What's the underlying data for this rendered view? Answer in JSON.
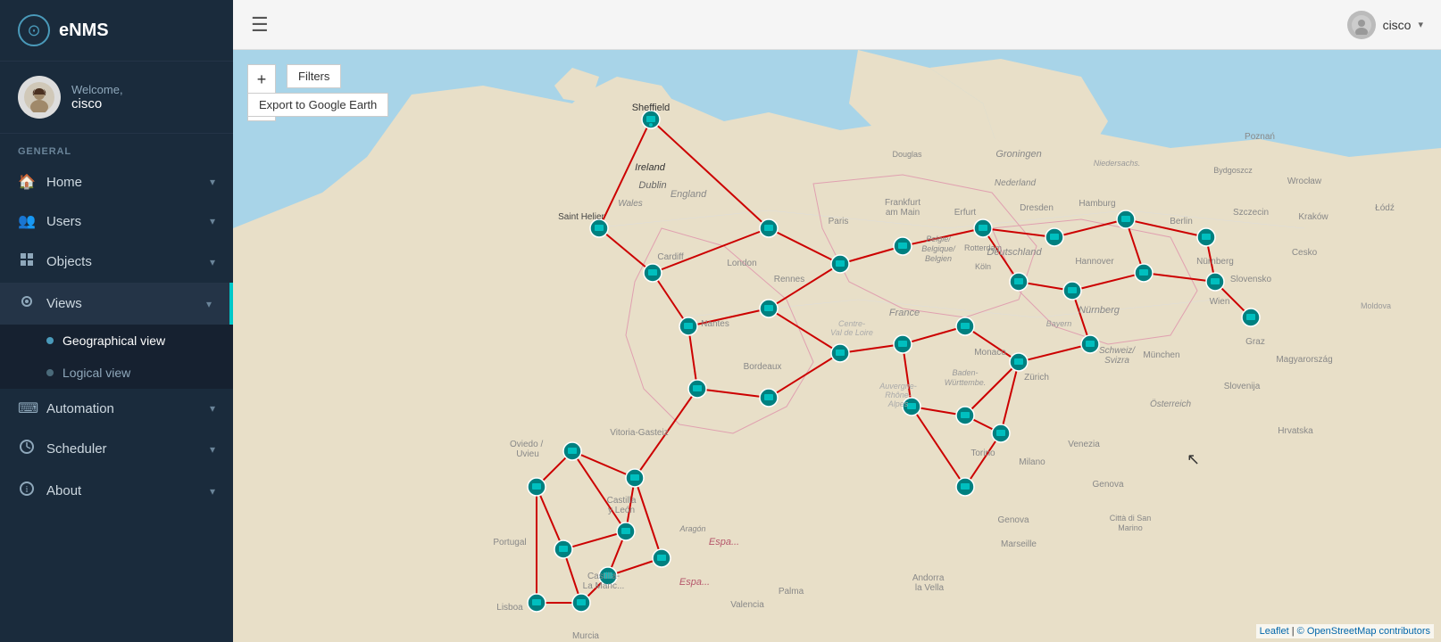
{
  "app": {
    "name": "eNMS"
  },
  "user": {
    "welcome": "Welcome,",
    "name": "cisco",
    "avatar_char": "👤"
  },
  "sidebar": {
    "general_label": "GENERAL",
    "items": [
      {
        "id": "home",
        "label": "Home",
        "icon": "🏠",
        "has_children": true
      },
      {
        "id": "users",
        "label": "Users",
        "icon": "👥",
        "has_children": true
      },
      {
        "id": "objects",
        "label": "Objects",
        "icon": "📦",
        "has_children": true
      },
      {
        "id": "views",
        "label": "Views",
        "icon": "📍",
        "has_children": true,
        "active": true,
        "children": [
          {
            "id": "geographical-view",
            "label": "Geographical view",
            "active": true
          },
          {
            "id": "logical-view",
            "label": "Logical view",
            "active": false
          }
        ]
      },
      {
        "id": "automation",
        "label": "Automation",
        "icon": "⌨",
        "has_children": true
      },
      {
        "id": "scheduler",
        "label": "Scheduler",
        "icon": "🕐",
        "has_children": true
      },
      {
        "id": "about",
        "label": "About",
        "icon": "ℹ",
        "has_children": true
      }
    ]
  },
  "topbar": {
    "hamburger": "☰",
    "user_name": "cisco"
  },
  "map": {
    "zoom_in": "+",
    "zoom_out": "−",
    "filters_label": "Filters",
    "export_label": "Export to Google Earth",
    "attribution_leaflet": "Leaflet",
    "attribution_osm": "© OpenStreetMap contributors"
  }
}
